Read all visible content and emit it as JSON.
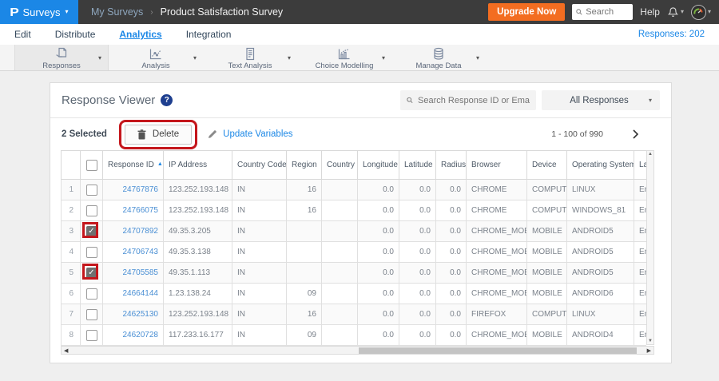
{
  "brand": {
    "logo": "P",
    "product_label": "Surveys"
  },
  "topbar": {
    "breadcrumb_parent": "My Surveys",
    "breadcrumb_sep": "›",
    "breadcrumb_current": "Product Satisfaction Survey",
    "upgrade_label": "Upgrade Now",
    "search_placeholder": "Search",
    "help_label": "Help"
  },
  "nav": {
    "tabs": [
      {
        "label": "Edit",
        "active": false
      },
      {
        "label": "Distribute",
        "active": false
      },
      {
        "label": "Analytics",
        "active": true
      },
      {
        "label": "Integration",
        "active": false
      }
    ],
    "responses_count": "Responses: 202"
  },
  "toolbar": {
    "items": [
      {
        "label": "Responses",
        "icon": "responses-icon",
        "active": true
      },
      {
        "label": "Analysis",
        "icon": "analysis-icon",
        "active": false
      },
      {
        "label": "Text Analysis",
        "icon": "text-analysis-icon",
        "active": false
      },
      {
        "label": "Choice Modelling",
        "icon": "choice-modelling-icon",
        "active": false
      },
      {
        "label": "Manage Data",
        "icon": "manage-data-icon",
        "active": false
      }
    ]
  },
  "panel": {
    "title": "Response Viewer",
    "help_badge": "?",
    "search_placeholder": "Search Response ID or Email",
    "filter_value": "All Responses",
    "selected_label": "2 Selected",
    "delete_label": "Delete",
    "update_variables_label": "Update Variables",
    "pagination_label": "1 - 100 of 990"
  },
  "table": {
    "columns": [
      "",
      "",
      "Response ID",
      "IP Address",
      "Country Code",
      "Region",
      "Country",
      "Longitude",
      "Latitude",
      "Radius",
      "Browser",
      "Device",
      "Operating System",
      "Language"
    ],
    "sort_column_index": 2,
    "sort_arrow": "▲",
    "rows": [
      {
        "num": "1",
        "checked": false,
        "highlighted": false,
        "response_id": "24767876",
        "ip": "123.252.193.148",
        "country_code": "IN",
        "region": "16",
        "country": "",
        "longitude": "0.0",
        "latitude": "0.0",
        "radius": "0.0",
        "browser": "CHROME",
        "device": "COMPUTER",
        "os": "LINUX",
        "language": "English"
      },
      {
        "num": "2",
        "checked": false,
        "highlighted": false,
        "response_id": "24766075",
        "ip": "123.252.193.148",
        "country_code": "IN",
        "region": "16",
        "country": "",
        "longitude": "0.0",
        "latitude": "0.0",
        "radius": "0.0",
        "browser": "CHROME",
        "device": "COMPUTER",
        "os": "WINDOWS_81",
        "language": "English"
      },
      {
        "num": "3",
        "checked": true,
        "highlighted": true,
        "response_id": "24707892",
        "ip": "49.35.3.205",
        "country_code": "IN",
        "region": "",
        "country": "",
        "longitude": "0.0",
        "latitude": "0.0",
        "radius": "0.0",
        "browser": "CHROME_MOBILE",
        "device": "MOBILE",
        "os": "ANDROID5",
        "language": "English"
      },
      {
        "num": "4",
        "checked": false,
        "highlighted": false,
        "response_id": "24706743",
        "ip": "49.35.3.138",
        "country_code": "IN",
        "region": "",
        "country": "",
        "longitude": "0.0",
        "latitude": "0.0",
        "radius": "0.0",
        "browser": "CHROME_MOBILE",
        "device": "MOBILE",
        "os": "ANDROID5",
        "language": "English"
      },
      {
        "num": "5",
        "checked": true,
        "highlighted": true,
        "response_id": "24705585",
        "ip": "49.35.1.113",
        "country_code": "IN",
        "region": "",
        "country": "",
        "longitude": "0.0",
        "latitude": "0.0",
        "radius": "0.0",
        "browser": "CHROME_MOBILE",
        "device": "MOBILE",
        "os": "ANDROID5",
        "language": "English"
      },
      {
        "num": "6",
        "checked": false,
        "highlighted": false,
        "response_id": "24664144",
        "ip": "1.23.138.24",
        "country_code": "IN",
        "region": "09",
        "country": "",
        "longitude": "0.0",
        "latitude": "0.0",
        "radius": "0.0",
        "browser": "CHROME_MOBILE",
        "device": "MOBILE",
        "os": "ANDROID6",
        "language": "English"
      },
      {
        "num": "7",
        "checked": false,
        "highlighted": false,
        "response_id": "24625130",
        "ip": "123.252.193.148",
        "country_code": "IN",
        "region": "16",
        "country": "",
        "longitude": "0.0",
        "latitude": "0.0",
        "radius": "0.0",
        "browser": "FIREFOX",
        "device": "COMPUTER",
        "os": "LINUX",
        "language": "English"
      },
      {
        "num": "8",
        "checked": false,
        "highlighted": false,
        "response_id": "24620728",
        "ip": "117.233.16.177",
        "country_code": "IN",
        "region": "09",
        "country": "",
        "longitude": "0.0",
        "latitude": "0.0",
        "radius": "0.0",
        "browser": "CHROME_MOBILE",
        "device": "MOBILE",
        "os": "ANDROID4",
        "language": "English"
      }
    ]
  },
  "colors": {
    "accent_blue": "#1b87e6",
    "upgrade_orange": "#f36d21",
    "annotation_red": "#c4161c",
    "link_blue": "#4a8fd4",
    "topbar_dark": "#3c3c3c"
  }
}
